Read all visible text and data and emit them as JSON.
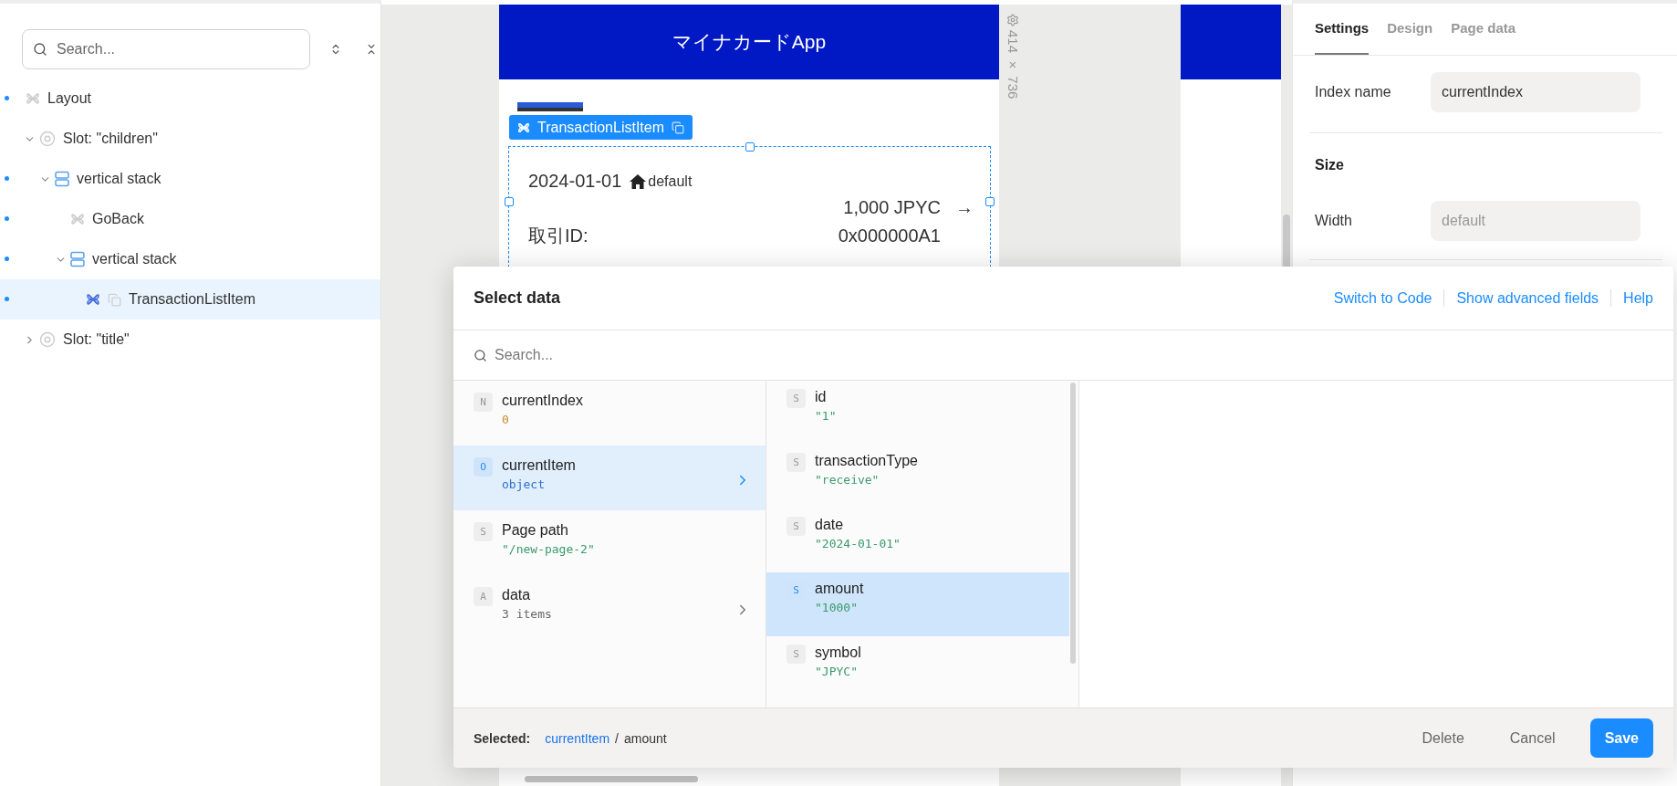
{
  "tree_panel": {
    "search": {
      "placeholder": "Search..."
    },
    "nodes": [
      {
        "label": "Layout",
        "kind": "component",
        "marked": true,
        "selected": false,
        "children": [
          {
            "label": "Slot: \"children\"",
            "kind": "slot",
            "marked": false,
            "selected": false,
            "expanded": true,
            "children": [
              {
                "label": "vertical stack",
                "kind": "stack",
                "marked": true,
                "selected": false,
                "expanded": true,
                "children": [
                  {
                    "label": "GoBack",
                    "kind": "component",
                    "marked": true,
                    "selected": false
                  },
                  {
                    "label": "vertical stack",
                    "kind": "stack",
                    "marked": true,
                    "selected": false,
                    "expanded": true,
                    "children": [
                      {
                        "label": "TransactionListItem",
                        "kind": "instance",
                        "marked": true,
                        "selected": true
                      }
                    ]
                  }
                ]
              }
            ]
          },
          {
            "label": "Slot: \"title\"",
            "kind": "slot",
            "marked": false,
            "selected": false,
            "expanded": false
          }
        ]
      }
    ]
  },
  "canvas": {
    "app_title": "マイナカードApp",
    "size_label": "414 × 736",
    "component_badge": "TransactionListItem",
    "item": {
      "date": "2024-01-01",
      "status": "default",
      "amount": "1,000 JPYC",
      "arrow": "→",
      "id_label": "取引ID:",
      "id_value": "0x000000A1"
    }
  },
  "inspector": {
    "tabs": [
      {
        "label": "Settings",
        "selected": true
      },
      {
        "label": "Design",
        "selected": false
      },
      {
        "label": "Page data",
        "selected": false
      }
    ],
    "index_field": {
      "label": "Index name",
      "value": "currentIndex"
    },
    "size_section": {
      "title": "Size",
      "width_field": {
        "label": "Width",
        "placeholder": "default"
      }
    }
  },
  "dialog": {
    "title": "Select data",
    "links": [
      "Switch to Code",
      "Show advanced fields",
      "Help"
    ],
    "search": {
      "placeholder": "Search..."
    },
    "columns": [
      [
        {
          "badge": "N",
          "kind": "number",
          "name": "currentIndex",
          "value": "0",
          "selected": false,
          "has_children": false
        },
        {
          "badge": "O",
          "kind": "object",
          "name": "currentItem",
          "value": "object",
          "selected": true,
          "has_children": true
        },
        {
          "badge": "S",
          "kind": "string",
          "name": "Page path",
          "value": "\"/new-page-2\"",
          "selected": false,
          "has_children": false
        },
        {
          "badge": "A",
          "kind": "array",
          "name": "data",
          "value": "3 items",
          "selected": false,
          "has_children": true
        }
      ],
      [
        {
          "badge": "S",
          "kind": "string",
          "name": "id",
          "value": "\"1\"",
          "selected": false,
          "has_children": false
        },
        {
          "badge": "S",
          "kind": "string",
          "name": "transactionType",
          "value": "\"receive\"",
          "selected": false,
          "has_children": false
        },
        {
          "badge": "S",
          "kind": "string",
          "name": "date",
          "value": "\"2024-01-01\"",
          "selected": false,
          "has_children": false
        },
        {
          "badge": "S",
          "kind": "string",
          "name": "amount",
          "value": "\"1000\"",
          "selected": true,
          "has_children": false
        },
        {
          "badge": "S",
          "kind": "string",
          "name": "symbol",
          "value": "\"JPYC\"",
          "selected": false,
          "has_children": false
        }
      ]
    ],
    "footer": {
      "label": "Selected:",
      "path": [
        {
          "text": "currentItem",
          "kind": "link"
        },
        {
          "text": "/",
          "kind": "separator"
        },
        {
          "text": "amount",
          "kind": "current"
        }
      ],
      "buttons": [
        {
          "label": "Delete",
          "kind": "text"
        },
        {
          "label": "Cancel",
          "kind": "text"
        },
        {
          "label": "Save",
          "kind": "primary"
        }
      ]
    }
  }
}
